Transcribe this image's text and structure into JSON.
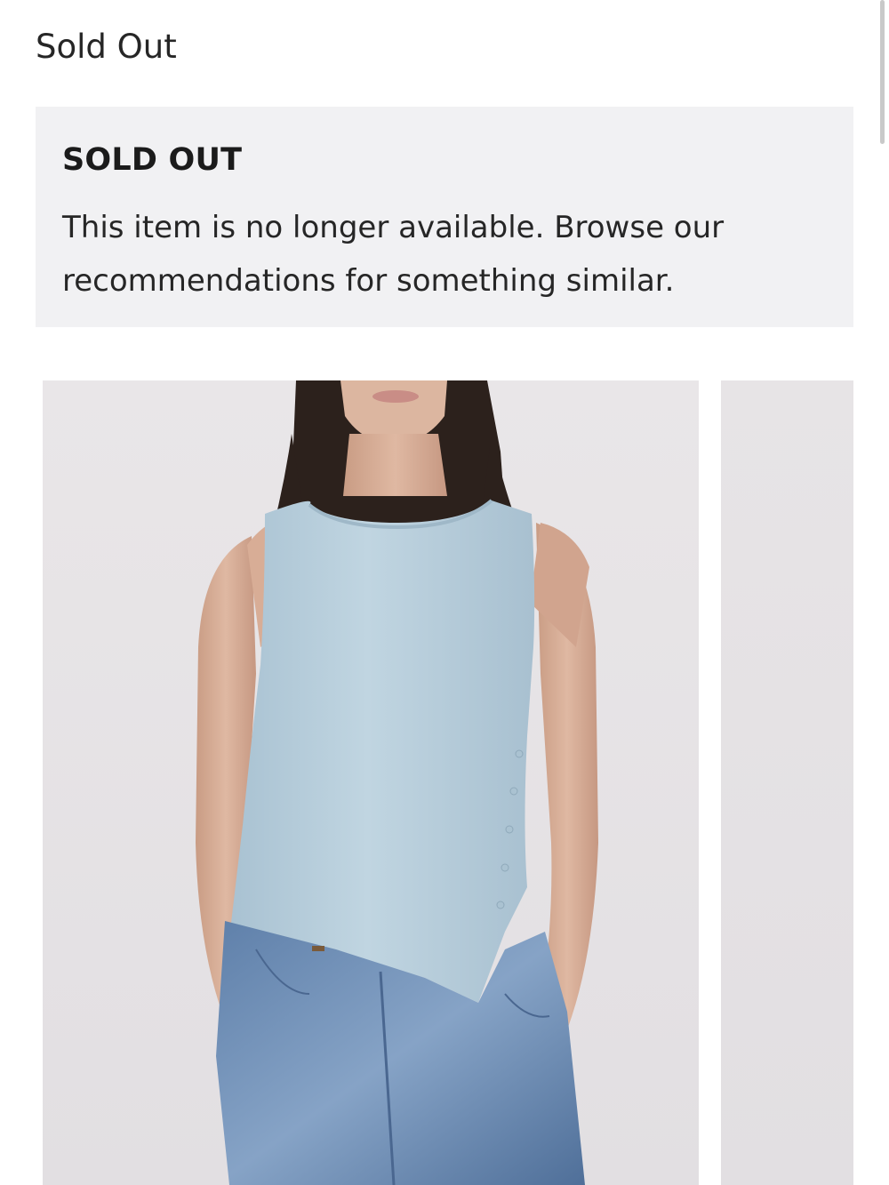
{
  "page": {
    "status_title": "Sold Out"
  },
  "notice": {
    "heading": "SOLD OUT",
    "message": "This item is no longer available. Browse our recommendations for something similar."
  },
  "gallery": {
    "images": [
      {
        "subject": "model wearing light blue sleeveless ribbed tank top with side buttons and blue jeans"
      },
      {
        "subject": "next product image (partially visible)"
      }
    ]
  },
  "colors": {
    "notice_background": "#f1f1f3",
    "top_color": "#b9cfdc",
    "denim": "#6f8fb5",
    "photo_background": "#e6e3e6"
  }
}
